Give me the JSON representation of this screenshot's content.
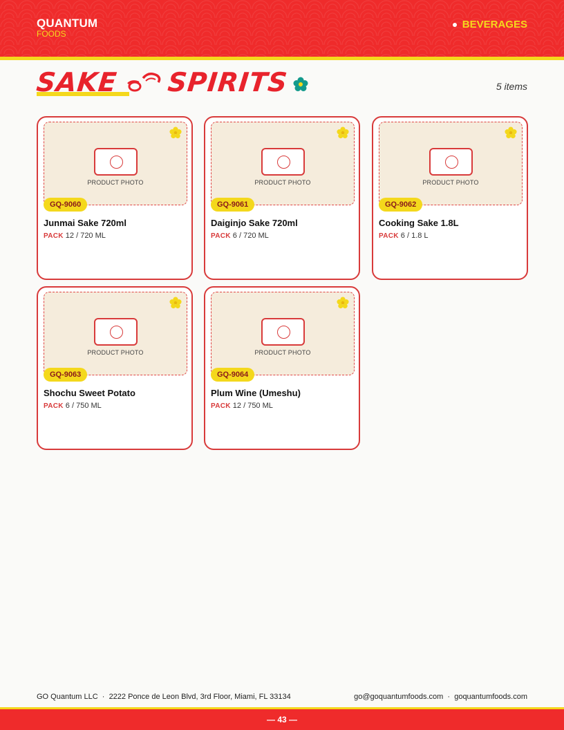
{
  "header": {
    "brand_name": "QUANTUM",
    "brand_sub": "FOODS",
    "category": "BEVERAGES"
  },
  "section": {
    "title": "SAKE",
    "title_2": "SPIRITS",
    "item_count": "5 items"
  },
  "photo_placeholder_label": "PRODUCT PHOTO",
  "pack_label": "PACK",
  "products": [
    {
      "sku": "GQ-9060",
      "name": "Junmai Sake 720ml",
      "pack": "12 / 720 ML"
    },
    {
      "sku": "GQ-9061",
      "name": "Daiginjo Sake 720ml",
      "pack": "6 / 720 ML"
    },
    {
      "sku": "GQ-9062",
      "name": "Cooking Sake 1.8L",
      "pack": "6 / 1.8 L"
    },
    {
      "sku": "GQ-9063",
      "name": "Shochu Sweet Potato",
      "pack": "6 / 750 ML"
    },
    {
      "sku": "GQ-9064",
      "name": "Plum Wine (Umeshu)",
      "pack": "12 / 750 ML"
    }
  ],
  "footer": {
    "company": "GO Quantum LLC",
    "address": "2222 Ponce de Leon Blvd, 3rd Floor, Miami, FL 33134",
    "email": "go@goquantumfoods.com",
    "website": "goquantumfoods.com",
    "page_number": "— 43 —"
  },
  "colors": {
    "brand_red": "#ef2b2b",
    "accent_yellow": "#f4d81c",
    "card_border": "#d83a3a",
    "photo_bg": "#f5ecdc",
    "teal_flower": "#139a8c"
  },
  "icons": {
    "camera": "camera-icon",
    "flower": "flower-icon",
    "fish": "fish-icon"
  }
}
